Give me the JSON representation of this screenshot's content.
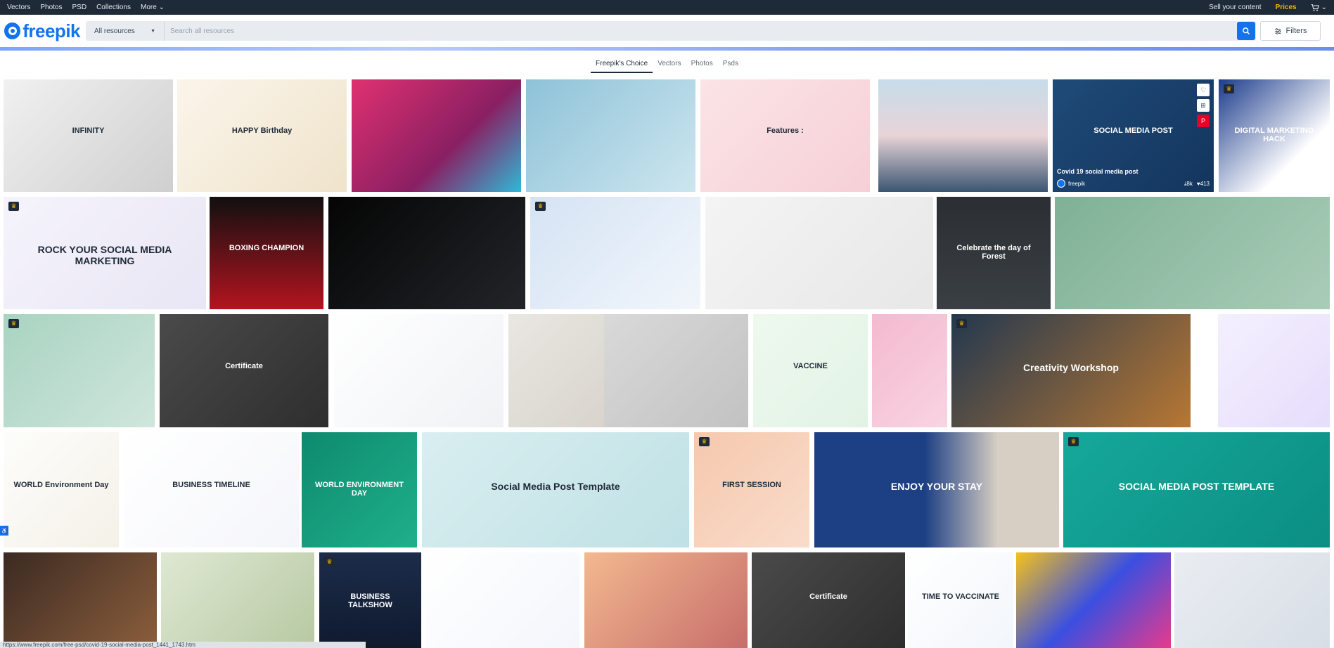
{
  "topnav": {
    "links": [
      "Vectors",
      "Photos",
      "PSD",
      "Collections",
      "More"
    ],
    "sell": "Sell your content",
    "prices": "Prices"
  },
  "header": {
    "logo_text": "freepik",
    "category": "All resources",
    "search_placeholder": "Search all resources",
    "filters_label": "Filters"
  },
  "tabs": [
    "Freepik's Choice",
    "Vectors",
    "Photos",
    "Psds"
  ],
  "tiles": [
    {
      "bg": "linear-gradient(135deg,#f1f1f1,#cfcfcf)",
      "text": "INFINITY",
      "premium": false
    },
    {
      "bg": "linear-gradient(135deg,#fbf5ea,#efe3cb)",
      "text": "HAPPY Birthday",
      "premium": false
    },
    {
      "bg": "linear-gradient(135deg,#e0316f,#8a1f63 60%,#2fb8d6)",
      "text": "",
      "premium": false
    },
    {
      "bg": "linear-gradient(135deg,#8ec2d8,#cde6ef)",
      "text": "",
      "premium": false
    },
    {
      "bg": "linear-gradient(135deg,#fbe4e6,#f6d0d7)",
      "text": "Features :",
      "premium": false
    },
    {
      "bg": "linear-gradient(180deg,#c7dcea 0%,#e8d4d8 50%,#3a5672 100%)",
      "text": "",
      "premium": false
    },
    {
      "bg": "linear-gradient(135deg,#1f4a78,#13355d)",
      "text": "SOCIAL MEDIA POST",
      "premium": false,
      "caption": "Covid 19 social media post",
      "author": "freepik",
      "downloads": "8k",
      "likes": "413"
    },
    {
      "bg": "linear-gradient(135deg,#1c3c8c,#ffffff 70%)",
      "text": "DIGITAL MARKETING HACK",
      "premium": true
    },
    {
      "bg": "linear-gradient(135deg,#f5f3fb,#e9e6f5)",
      "text": "ROCK YOUR SOCIAL MEDIA MARKETING",
      "premium": true
    },
    {
      "bg": "linear-gradient(180deg,#101010,#b3141f)",
      "text": "BOXING CHAMPION",
      "premium": false
    },
    {
      "bg": "linear-gradient(135deg,#050505,#222428)",
      "text": "",
      "premium": false
    },
    {
      "bg": "linear-gradient(135deg,#d4e3f4,#f2f6fb)",
      "text": "",
      "premium": true
    },
    {
      "bg": "linear-gradient(135deg,#f4f4f4,#e7e7e7)",
      "text": "",
      "premium": false
    },
    {
      "bg": "linear-gradient(180deg,#2b2f33,#3a3f44)",
      "text": "Celebrate the day of Forest",
      "premium": false
    },
    {
      "bg": "linear-gradient(135deg,#7fb196,#a9ccb7)",
      "text": "",
      "premium": false
    },
    {
      "bg": "linear-gradient(135deg,#a9d3c1,#cfe6dc)",
      "text": "",
      "premium": true
    },
    {
      "bg": "linear-gradient(135deg,#4a4a4a,#2e2e2e)",
      "text": "Certificate",
      "premium": false
    },
    {
      "bg": "linear-gradient(135deg,#ffffff,#f0f2f5)",
      "text": "",
      "premium": false
    },
    {
      "bg": "linear-gradient(135deg,#e9e7e2,#d8d4cc)",
      "text": "",
      "premium": false
    },
    {
      "bg": "linear-gradient(135deg,#d9d9d9,#c2c2c2)",
      "text": "",
      "premium": false
    },
    {
      "bg": "linear-gradient(135deg,#eef8ef,#e2f3e6)",
      "text": "VACCINE",
      "premium": false
    },
    {
      "bg": "linear-gradient(135deg,#f5b9cf,#f8d4e2)",
      "text": "",
      "premium": false
    },
    {
      "bg": "linear-gradient(135deg,#22384f,#e48a2a 130%)",
      "text": "Creativity Workshop",
      "premium": true
    },
    {
      "bg": "linear-gradient(135deg,#f4f0ff,#e6ddfb)",
      "text": "",
      "premium": false
    },
    {
      "bg": "linear-gradient(135deg,#fdfdfb,#f4f1e8)",
      "text": "WORLD Environment Day",
      "premium": false
    },
    {
      "bg": "linear-gradient(135deg,#ffffff,#f5f6fa)",
      "text": "BUSINESS TIMELINE",
      "premium": false
    },
    {
      "bg": "linear-gradient(135deg,#0e8a6f,#1fb08a)",
      "text": "WORLD ENVIRONMENT DAY",
      "premium": false
    },
    {
      "bg": "linear-gradient(135deg,#d9eef0,#bfe1e5)",
      "text": "Social Media Post Template",
      "premium": false
    },
    {
      "bg": "linear-gradient(135deg,#f6c8ad,#f9dccb)",
      "text": "FIRST SESSION",
      "premium": true
    },
    {
      "bg": "linear-gradient(90deg,#1d3f84 0%,#1d3f84 45%,#d8cfc4 75%)",
      "text": "ENJOY YOUR STAY",
      "premium": false
    },
    {
      "bg": "linear-gradient(135deg,#15a89a,#0c8e84)",
      "text": "SOCIAL MEDIA POST TEMPLATE",
      "premium": true
    },
    {
      "bg": "linear-gradient(135deg,#3b2a22,#8b5e3c)",
      "text": "",
      "premium": false
    },
    {
      "bg": "linear-gradient(135deg,#dfe8d2,#b7c9a3)",
      "text": "",
      "premium": false
    },
    {
      "bg": "linear-gradient(180deg,#1c2c4a,#0f1a2e)",
      "text": "BUSINESS TALKSHOW",
      "premium": true
    },
    {
      "bg": "linear-gradient(135deg,#ffffff,#f3f6fb)",
      "text": "",
      "premium": false
    },
    {
      "bg": "linear-gradient(135deg,#f3b98f,#c76e6a)",
      "text": "",
      "premium": false
    },
    {
      "bg": "linear-gradient(135deg,#4a4a4a,#2e2e2e)",
      "text": "Certificate",
      "premium": false
    },
    {
      "bg": "linear-gradient(135deg,#ffffff,#f2f6fb)",
      "text": "TIME TO VACCINATE",
      "premium": false
    },
    {
      "bg": "linear-gradient(135deg,#f6c21a,#3a4fe0 50%,#e73a8c)",
      "text": "",
      "premium": false
    },
    {
      "bg": "linear-gradient(135deg,#e9edf2,#d8dee6)",
      "text": "",
      "premium": false
    }
  ],
  "statusbar": "https://www.freepik.com/free-psd/covid-19-social-media-post_1441_1743.htm"
}
